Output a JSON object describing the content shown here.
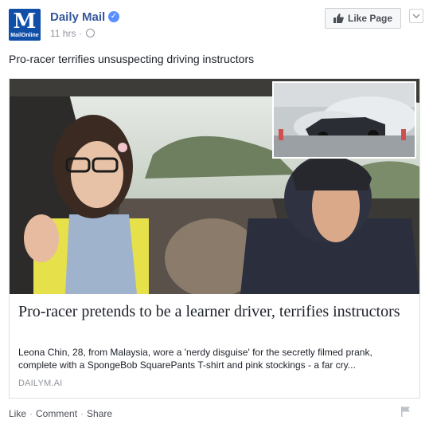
{
  "header": {
    "avatar_text": "M",
    "avatar_sub": "MailOnline",
    "page_name": "Daily Mail",
    "timestamp": "11 hrs",
    "separator": "·",
    "like_page_label": "Like Page"
  },
  "post": {
    "caption": "Pro-racer terrifies unsuspecting driving instructors"
  },
  "link_card": {
    "title": "Pro-racer pretends to be a learner driver, terrifies instructors",
    "description": "Leona Chin, 28, from Malaysia, wore a 'nerdy disguise' for the secretly filmed prank, complete with a SpongeBob SquarePants T-shirt and pink stockings - a far cry...",
    "domain": "DAILYM.AI"
  },
  "actions": {
    "like": "Like",
    "comment": "Comment",
    "share": "Share",
    "separator": "·"
  },
  "colors": {
    "link_blue": "#365899",
    "brand_blue": "#0f4fa8",
    "verified_blue": "#5890ff",
    "muted_gray": "#90949c"
  },
  "icons": [
    "verified-badge-icon",
    "globe-icon",
    "thumbs-up-icon",
    "chevron-down-icon",
    "flag-icon"
  ]
}
